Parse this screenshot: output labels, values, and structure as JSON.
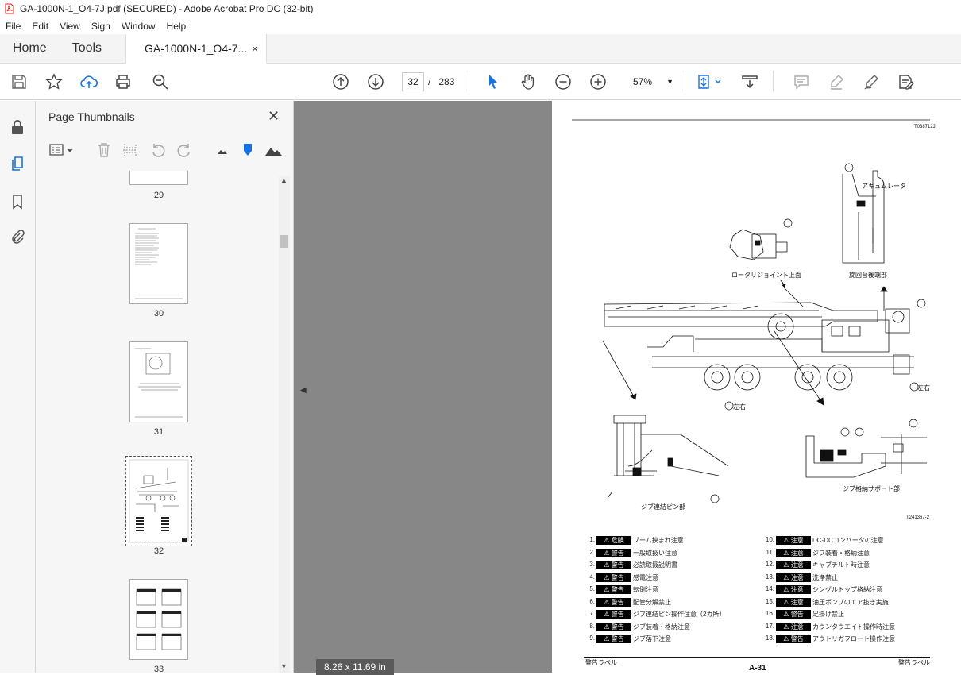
{
  "window": {
    "title": "GA-1000N-1_O4-7J.pdf (SECURED) - Adobe Acrobat Pro DC (32-bit)"
  },
  "menu": [
    "File",
    "Edit",
    "View",
    "Sign",
    "Window",
    "Help"
  ],
  "tabs": {
    "home": "Home",
    "tools": "Tools",
    "document": "GA-1000N-1_O4-7...",
    "close": "×"
  },
  "toolbar": {
    "page_current": "32",
    "page_sep": "/",
    "page_total": "283",
    "zoom": "57%"
  },
  "panel": {
    "title": "Page Thumbnails",
    "close": "✕",
    "thumbnails": [
      "29",
      "30",
      "31",
      "32",
      "33"
    ],
    "selected": "32"
  },
  "viewer": {
    "page_size": "8.26 x 11.69 in"
  },
  "document": {
    "code_top": "T038712J",
    "code_mid": "T241367-2",
    "callouts": {
      "accumulator": "アキュムレータ",
      "rotary": "ロータリジョイント上面",
      "slewing": "旋回台後端部",
      "jib_pin": "ジブ連結ピン部",
      "jib_support": "ジブ格納サポート部",
      "left_right_a": "左右",
      "left_right_b": "左右",
      "left_right_c": "左右"
    },
    "labels_left": [
      {
        "num": "1.",
        "badge": "危険",
        "text": "ブーム挟まれ注意"
      },
      {
        "num": "2.",
        "badge": "警告",
        "text": "一般取扱い注意"
      },
      {
        "num": "3.",
        "badge": "警告",
        "text": "必読取扱説明書"
      },
      {
        "num": "4.",
        "badge": "警告",
        "text": "感電注意"
      },
      {
        "num": "5.",
        "badge": "警告",
        "text": "転倒注意"
      },
      {
        "num": "6.",
        "badge": "警告",
        "text": "配管分解禁止"
      },
      {
        "num": "7.",
        "badge": "警告",
        "text": "ジブ連結ピン操作注意（2カ所）"
      },
      {
        "num": "8.",
        "badge": "警告",
        "text": "ジブ装着・格納注意"
      },
      {
        "num": "9.",
        "badge": "警告",
        "text": "ジブ落下注意"
      }
    ],
    "labels_right": [
      {
        "num": "10.",
        "badge": "注意",
        "text": "DC-DCコンバータの注意"
      },
      {
        "num": "11.",
        "badge": "注意",
        "text": "ジブ装着・格納注意"
      },
      {
        "num": "12.",
        "badge": "注意",
        "text": "キャブチルト時注意"
      },
      {
        "num": "13.",
        "badge": "注意",
        "text": "洗浄禁止"
      },
      {
        "num": "14.",
        "badge": "注意",
        "text": "シングルトップ格納注意"
      },
      {
        "num": "15.",
        "badge": "注意",
        "text": "油圧ポンプのエア抜き実施"
      },
      {
        "num": "16.",
        "badge": "警告",
        "text": "足掛け禁止"
      },
      {
        "num": "17.",
        "badge": "注意",
        "text": "カウンタウエイト操作時注意"
      },
      {
        "num": "18.",
        "badge": "警告",
        "text": "アウトリガフロート操作注意"
      }
    ],
    "footer_left": "警告ラベル",
    "footer_center": "A-31",
    "footer_right": "警告ラベル"
  }
}
